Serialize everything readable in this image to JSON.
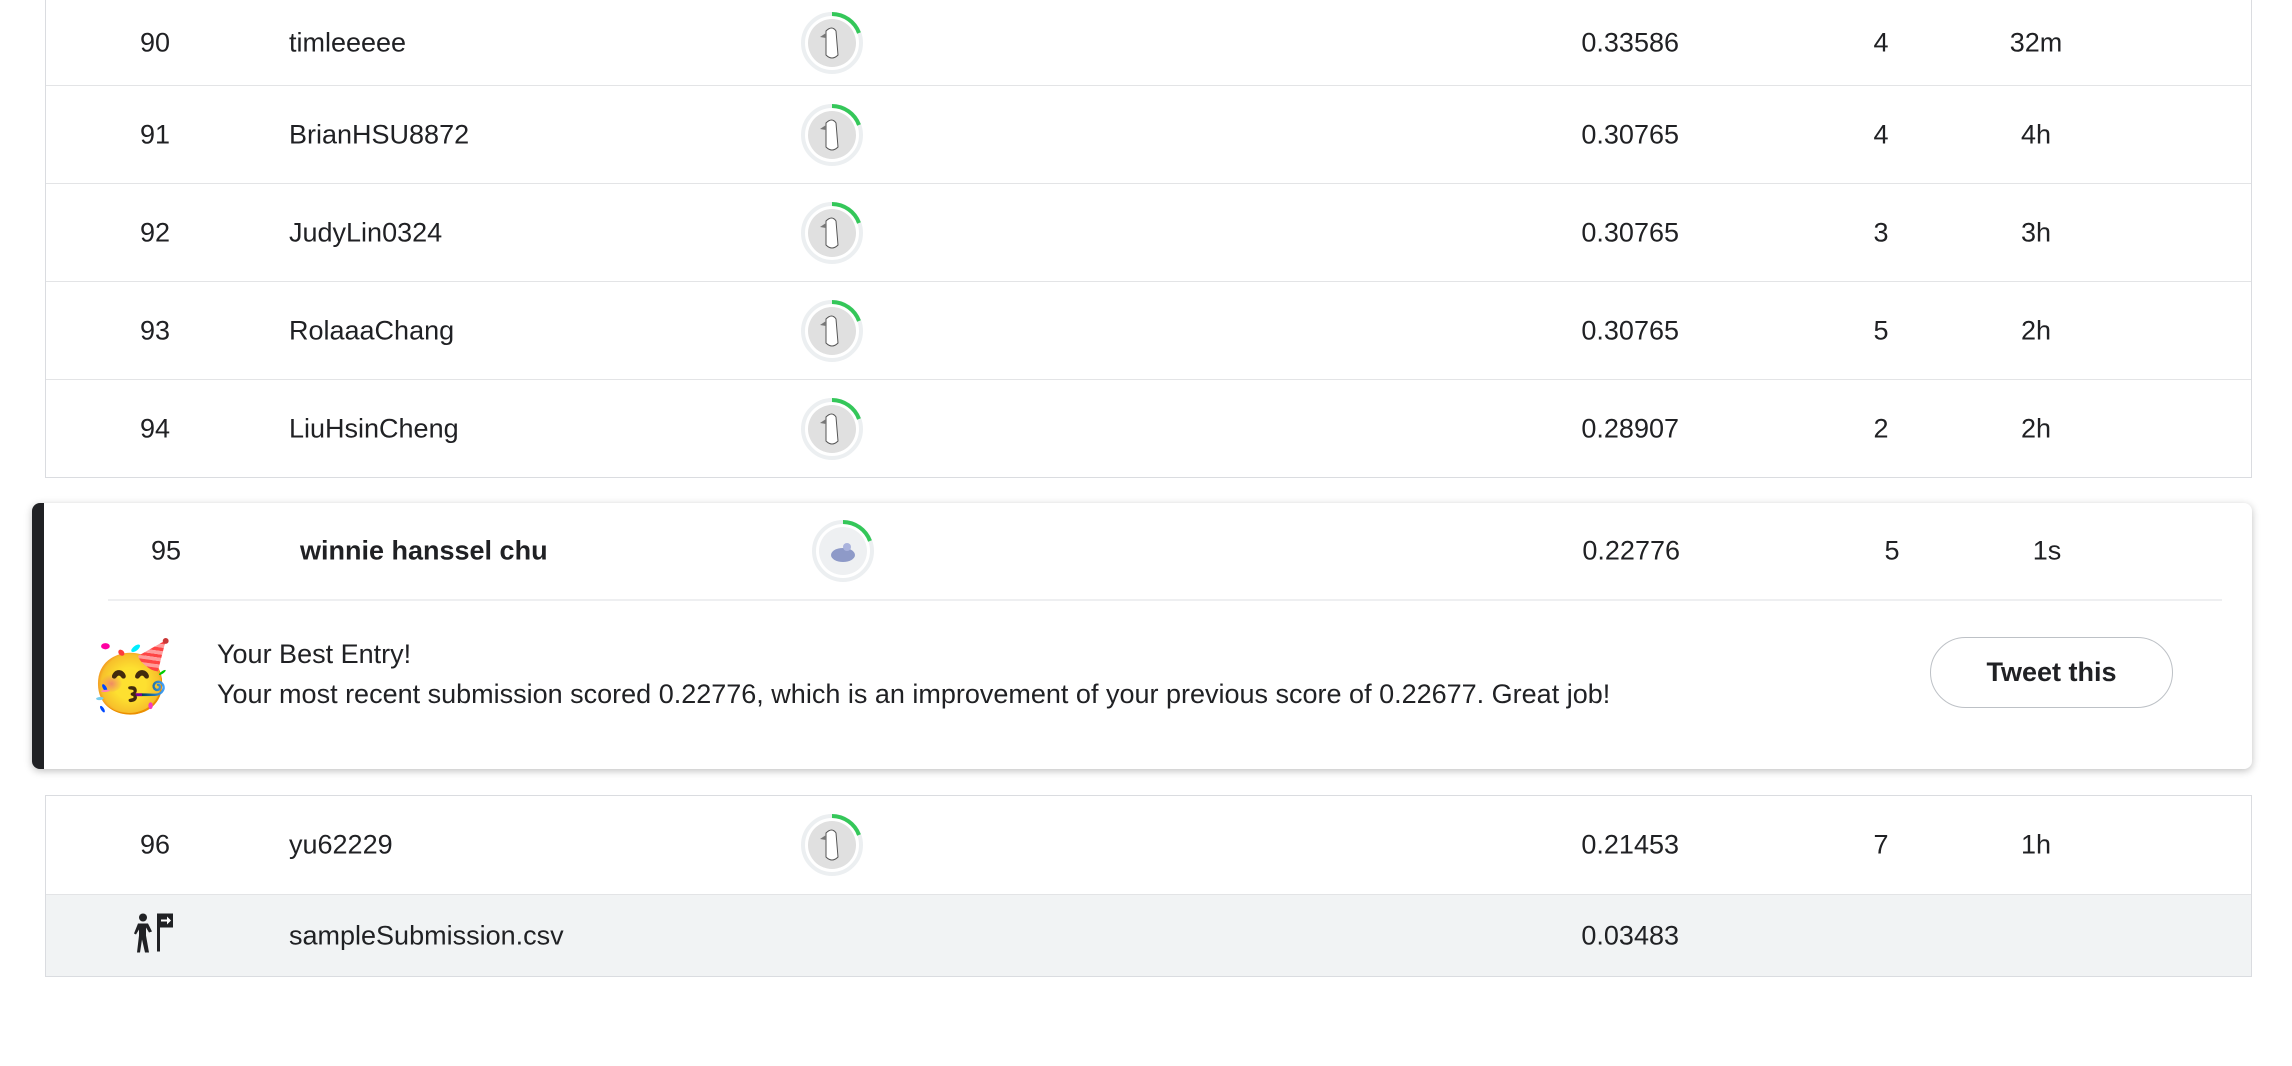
{
  "rows_top": [
    {
      "rank": "90",
      "name": "timleeeee",
      "score": "0.33586",
      "entries": "4",
      "last": "32m"
    },
    {
      "rank": "91",
      "name": "BrianHSU8872",
      "score": "0.30765",
      "entries": "4",
      "last": "4h"
    },
    {
      "rank": "92",
      "name": "JudyLin0324",
      "score": "0.30765",
      "entries": "3",
      "last": "3h"
    },
    {
      "rank": "93",
      "name": "RolaaaChang",
      "score": "0.30765",
      "entries": "5",
      "last": "2h"
    },
    {
      "rank": "94",
      "name": "LiuHsinCheng",
      "score": "0.28907",
      "entries": "2",
      "last": "2h"
    }
  ],
  "highlight": {
    "rank": "95",
    "name": "winnie hanssel chu",
    "score": "0.22776",
    "entries": "5",
    "last": "1s",
    "emoji": "🥳",
    "title": "Your Best Entry!",
    "message": "Your most recent submission scored 0.22776, which is an improvement of your previous score of 0.22677. Great job!",
    "tweet_label": "Tweet this"
  },
  "rows_bottom": [
    {
      "rank": "96",
      "name": "yu62229",
      "score": "0.21453",
      "entries": "7",
      "last": "1h"
    }
  ],
  "benchmark": {
    "icon": "benchmark-person-sign-icon",
    "name": "sampleSubmission.csv",
    "score": "0.03483"
  },
  "colors": {
    "progress_ring": "#34c759",
    "accent_border": "#202124",
    "benchmark_bg": "#f1f3f4"
  }
}
